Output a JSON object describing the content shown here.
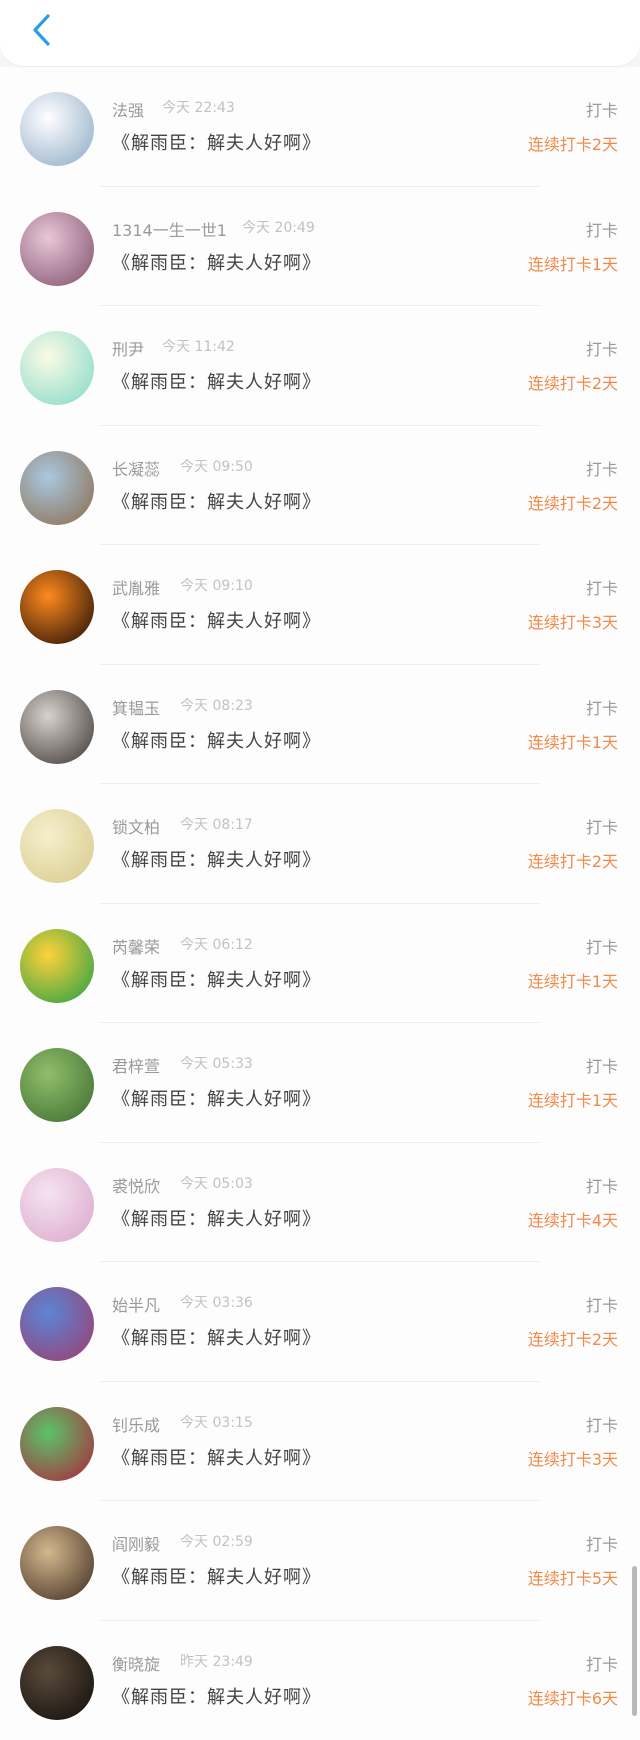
{
  "header": {
    "back_icon": "chevron-left-icon",
    "accent_color": "#2a9de6"
  },
  "common": {
    "action_label": "打卡",
    "streak_color": "#f08a4b"
  },
  "rows": [
    {
      "name": "法强",
      "time": "今天 22:43",
      "title": "《解雨臣：解夫人好啊》",
      "action": "打卡",
      "streak": "连续打卡2天",
      "avatar_colors": [
        "#ffffff",
        "#8aa8c4"
      ]
    },
    {
      "name": "1314一生一世1",
      "time": "今天 20:49",
      "title": "《解雨臣：解夫人好啊》",
      "action": "打卡",
      "streak": "连续打卡1天",
      "avatar_colors": [
        "#e8c7d8",
        "#7d4f6c"
      ]
    },
    {
      "name": "刑尹",
      "time": "今天 11:42",
      "title": "《解雨臣：解夫人好啊》",
      "action": "打卡",
      "streak": "连续打卡2天",
      "avatar_colors": [
        "#fbfbe6",
        "#7fd8c8"
      ]
    },
    {
      "name": "长凝蕊",
      "time": "今天 09:50",
      "title": "《解雨臣：解夫人好啊》",
      "action": "打卡",
      "streak": "连续打卡2天",
      "avatar_colors": [
        "#a9c8e0",
        "#8b6a4a"
      ]
    },
    {
      "name": "武胤雅",
      "time": "今天 09:10",
      "title": "《解雨臣：解夫人好啊》",
      "action": "打卡",
      "streak": "连续打卡3天",
      "avatar_colors": [
        "#ff8a1e",
        "#1a0a05"
      ]
    },
    {
      "name": "箕韫玉",
      "time": "今天 08:23",
      "title": "《解雨臣：解夫人好啊》",
      "action": "打卡",
      "streak": "连续打卡1天",
      "avatar_colors": [
        "#d8d2cc",
        "#3a3330"
      ]
    },
    {
      "name": "锁文柏",
      "time": "今天 08:17",
      "title": "《解雨臣：解夫人好啊》",
      "action": "打卡",
      "streak": "连续打卡2天",
      "avatar_colors": [
        "#f6efcc",
        "#d6c98a"
      ]
    },
    {
      "name": "芮馨荣",
      "time": "今天 06:12",
      "title": "《解雨臣：解夫人好啊》",
      "action": "打卡",
      "streak": "连续打卡1天",
      "avatar_colors": [
        "#ffd23a",
        "#1e9e46"
      ]
    },
    {
      "name": "君梓萱",
      "time": "今天 05:33",
      "title": "《解雨臣：解夫人好啊》",
      "action": "打卡",
      "streak": "连续打卡1天",
      "avatar_colors": [
        "#8fbf6a",
        "#3d6a30"
      ]
    },
    {
      "name": "裘悦欣",
      "time": "今天 05:03",
      "title": "《解雨臣：解夫人好啊》",
      "action": "打卡",
      "streak": "连续打卡4天",
      "avatar_colors": [
        "#f6e3f1",
        "#d9a6c9"
      ]
    },
    {
      "name": "始半凡",
      "time": "今天 03:36",
      "title": "《解雨臣：解夫人好啊》",
      "action": "打卡",
      "streak": "连续打卡2天",
      "avatar_colors": [
        "#5a86d6",
        "#a03a6a"
      ]
    },
    {
      "name": "钊乐成",
      "time": "今天 03:15",
      "title": "《解雨臣：解夫人好啊》",
      "action": "打卡",
      "streak": "连续打卡3天",
      "avatar_colors": [
        "#5bc46a",
        "#b0203a"
      ]
    },
    {
      "name": "阎刚毅",
      "time": "今天 02:59",
      "title": "《解雨臣：解夫人好啊》",
      "action": "打卡",
      "streak": "连续打卡5天",
      "avatar_colors": [
        "#d6b88e",
        "#3a2a1e"
      ]
    },
    {
      "name": "衡晓旋",
      "time": "昨天 23:49",
      "title": "《解雨臣：解夫人好啊》",
      "action": "打卡",
      "streak": "连续打卡6天",
      "avatar_colors": [
        "#5a4a3a",
        "#0f0c0a"
      ]
    }
  ]
}
